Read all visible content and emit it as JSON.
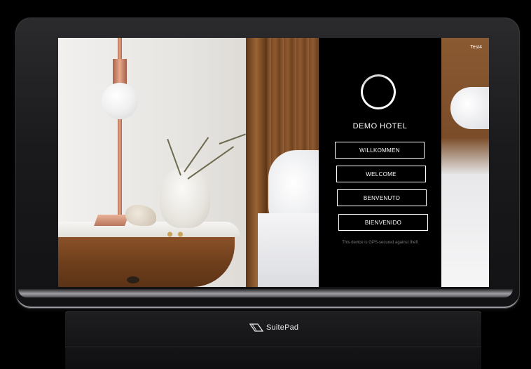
{
  "device": {
    "label": "Test4"
  },
  "welcome_screen": {
    "hotel_name": "DEMO HOTEL",
    "logo_icon": "ring-logo-icon",
    "languages": [
      {
        "label": "WILLKOMMEN"
      },
      {
        "label": "WELCOME"
      },
      {
        "label": "BENVENUTO"
      },
      {
        "label": "BIENVENIDO"
      }
    ],
    "security_note": "This device is GPS-secured against theft"
  },
  "dock": {
    "brand": "SuitePad",
    "brand_icon": "suitepad-logo-icon"
  },
  "colors": {
    "panel_bg": "#000000",
    "text": "#ffffff",
    "note_text": "#7d7d7d"
  }
}
